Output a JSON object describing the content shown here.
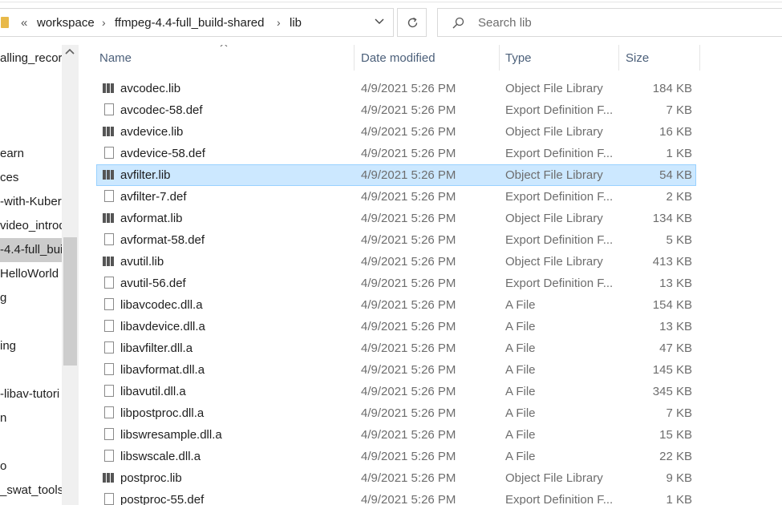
{
  "address": {
    "overflow_symbol": "«",
    "crumbs": [
      "workspace",
      "ffmpeg-4.4-full_build-shared",
      "lib"
    ],
    "separator": "›",
    "dropdown_glyph": "⌄",
    "refresh_glyph": "↻"
  },
  "search": {
    "placeholder": "Search lib",
    "icon": "search-icon"
  },
  "nav": {
    "items": [
      "alling_record",
      "",
      "",
      "",
      "earn",
      "ces",
      "-with-Kuber",
      "video_introd",
      "-4.4-full_bui",
      "HelloWorld",
      "g",
      "",
      "ing",
      "",
      "-libav-tutori",
      "n",
      "",
      "o",
      "_swat_tools"
    ],
    "selected_index": 8
  },
  "columns": {
    "name": "Name",
    "date": "Date modified",
    "type": "Type",
    "size": "Size"
  },
  "files": [
    {
      "name": "avcodec.lib",
      "date": "4/9/2021 5:26 PM",
      "type": "Object File Library",
      "size": "184 KB",
      "icon": "library-icon"
    },
    {
      "name": "avcodec-58.def",
      "date": "4/9/2021 5:26 PM",
      "type": "Export Definition F...",
      "size": "7 KB",
      "icon": "file-icon"
    },
    {
      "name": "avdevice.lib",
      "date": "4/9/2021 5:26 PM",
      "type": "Object File Library",
      "size": "16 KB",
      "icon": "library-icon"
    },
    {
      "name": "avdevice-58.def",
      "date": "4/9/2021 5:26 PM",
      "type": "Export Definition F...",
      "size": "1 KB",
      "icon": "file-icon"
    },
    {
      "name": "avfilter.lib",
      "date": "4/9/2021 5:26 PM",
      "type": "Object File Library",
      "size": "54 KB",
      "icon": "library-icon",
      "selected": true
    },
    {
      "name": "avfilter-7.def",
      "date": "4/9/2021 5:26 PM",
      "type": "Export Definition F...",
      "size": "2 KB",
      "icon": "file-icon"
    },
    {
      "name": "avformat.lib",
      "date": "4/9/2021 5:26 PM",
      "type": "Object File Library",
      "size": "134 KB",
      "icon": "library-icon"
    },
    {
      "name": "avformat-58.def",
      "date": "4/9/2021 5:26 PM",
      "type": "Export Definition F...",
      "size": "5 KB",
      "icon": "file-icon"
    },
    {
      "name": "avutil.lib",
      "date": "4/9/2021 5:26 PM",
      "type": "Object File Library",
      "size": "413 KB",
      "icon": "library-icon"
    },
    {
      "name": "avutil-56.def",
      "date": "4/9/2021 5:26 PM",
      "type": "Export Definition F...",
      "size": "13 KB",
      "icon": "file-icon"
    },
    {
      "name": "libavcodec.dll.a",
      "date": "4/9/2021 5:26 PM",
      "type": "A File",
      "size": "154 KB",
      "icon": "file-icon"
    },
    {
      "name": "libavdevice.dll.a",
      "date": "4/9/2021 5:26 PM",
      "type": "A File",
      "size": "13 KB",
      "icon": "file-icon"
    },
    {
      "name": "libavfilter.dll.a",
      "date": "4/9/2021 5:26 PM",
      "type": "A File",
      "size": "47 KB",
      "icon": "file-icon"
    },
    {
      "name": "libavformat.dll.a",
      "date": "4/9/2021 5:26 PM",
      "type": "A File",
      "size": "145 KB",
      "icon": "file-icon"
    },
    {
      "name": "libavutil.dll.a",
      "date": "4/9/2021 5:26 PM",
      "type": "A File",
      "size": "345 KB",
      "icon": "file-icon"
    },
    {
      "name": "libpostproc.dll.a",
      "date": "4/9/2021 5:26 PM",
      "type": "A File",
      "size": "7 KB",
      "icon": "file-icon"
    },
    {
      "name": "libswresample.dll.a",
      "date": "4/9/2021 5:26 PM",
      "type": "A File",
      "size": "15 KB",
      "icon": "file-icon"
    },
    {
      "name": "libswscale.dll.a",
      "date": "4/9/2021 5:26 PM",
      "type": "A File",
      "size": "22 KB",
      "icon": "file-icon"
    },
    {
      "name": "postproc.lib",
      "date": "4/9/2021 5:26 PM",
      "type": "Object File Library",
      "size": "9 KB",
      "icon": "library-icon"
    },
    {
      "name": "postproc-55.def",
      "date": "4/9/2021 5:26 PM",
      "type": "Export Definition F...",
      "size": "1 KB",
      "icon": "file-icon"
    }
  ],
  "colors": {
    "selection_bg": "#cce8ff",
    "selection_border": "#99d1ff",
    "header_text": "#4c607a"
  }
}
